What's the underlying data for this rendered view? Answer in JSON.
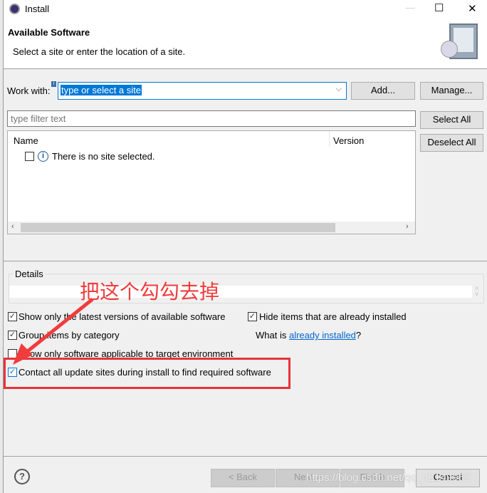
{
  "window": {
    "title": "Install",
    "minimize": "—",
    "maximize": "☐",
    "close": "✕"
  },
  "header": {
    "title": "Available Software",
    "subtitle": "Select a site or enter the location of a site."
  },
  "work_with": {
    "label": "Work with:",
    "value": "type or select a site",
    "add": "Add...",
    "manage": "Manage..."
  },
  "filter": {
    "placeholder": "type filter text",
    "select_all": "Select All",
    "deselect_all": "Deselect All"
  },
  "table": {
    "columns": [
      "Name",
      "Version"
    ],
    "rows": [
      {
        "text": "There is no site selected.",
        "checked": false
      }
    ]
  },
  "details": {
    "label": "Details"
  },
  "options": {
    "latest": {
      "label": "Show only the latest versions of available software",
      "checked": true
    },
    "hide": {
      "label": "Hide items that are already installed",
      "checked": true
    },
    "group": {
      "label": "Group items by category",
      "checked": true
    },
    "what_is": "What is ",
    "already_installed": "already installed",
    "qmark": "?",
    "target": {
      "label": "Show only software applicable to target environment",
      "checked": false
    },
    "contact": {
      "label": "Contact all update sites during install to find required software",
      "checked": true
    }
  },
  "annotation": {
    "text": "把这个勾勾去掉",
    "color": "#f03c3c"
  },
  "footer": {
    "back": "< Back",
    "next": "Next >",
    "finish": "Finish",
    "cancel": "Cancel",
    "help": "?"
  },
  "watermark": "https://blog.csdn.net/qq_42149963"
}
